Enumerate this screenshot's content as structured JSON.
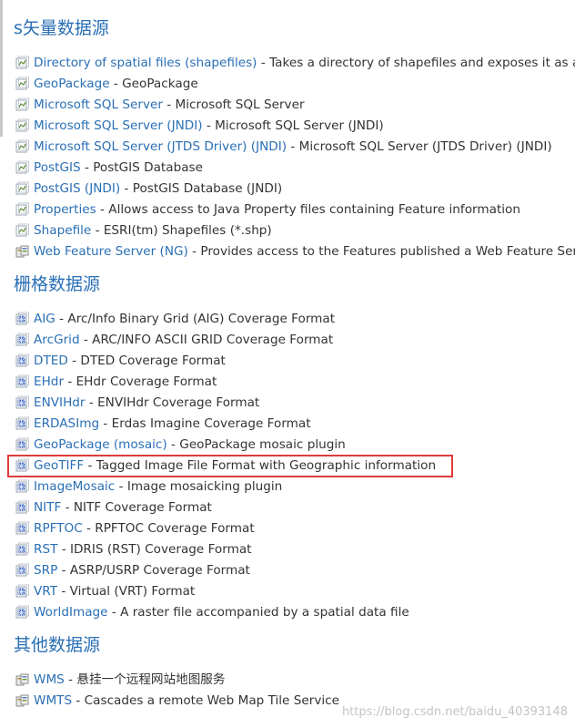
{
  "vector_section": {
    "title": "s矢量数据源",
    "items": [
      {
        "name": "Directory of spatial files (shapefiles)",
        "desc": "Takes a directory of shapefiles and exposes it as a data store",
        "icon": "vector-icon"
      },
      {
        "name": "GeoPackage",
        "desc": "GeoPackage",
        "icon": "vector-icon"
      },
      {
        "name": "Microsoft SQL Server",
        "desc": "Microsoft SQL Server",
        "icon": "vector-icon"
      },
      {
        "name": "Microsoft SQL Server (JNDI)",
        "desc": "Microsoft SQL Server (JNDI)",
        "icon": "vector-icon"
      },
      {
        "name": "Microsoft SQL Server (JTDS Driver) (JNDI)",
        "desc": "Microsoft SQL Server (JTDS Driver) (JNDI)",
        "icon": "vector-icon"
      },
      {
        "name": "PostGIS",
        "desc": "PostGIS Database",
        "icon": "vector-icon"
      },
      {
        "name": "PostGIS (JNDI)",
        "desc": "PostGIS Database (JNDI)",
        "icon": "vector-icon"
      },
      {
        "name": "Properties",
        "desc": "Allows access to Java Property files containing Feature information",
        "icon": "vector-icon"
      },
      {
        "name": "Shapefile",
        "desc": "ESRI(tm) Shapefiles (*.shp)",
        "icon": "vector-icon"
      },
      {
        "name": "Web Feature Server (NG)",
        "desc": "Provides access to the Features published a Web Feature Service, and th",
        "icon": "server-icon"
      }
    ]
  },
  "raster_section": {
    "title": "栅格数据源",
    "items": [
      {
        "name": "AIG",
        "desc": "Arc/Info Binary Grid (AIG) Coverage Format",
        "icon": "raster-icon"
      },
      {
        "name": "ArcGrid",
        "desc": "ARC/INFO ASCII GRID Coverage Format",
        "icon": "raster-icon"
      },
      {
        "name": "DTED",
        "desc": "DTED Coverage Format",
        "icon": "raster-icon"
      },
      {
        "name": "EHdr",
        "desc": "EHdr Coverage Format",
        "icon": "raster-icon"
      },
      {
        "name": "ENVIHdr",
        "desc": "ENVIHdr Coverage Format",
        "icon": "raster-icon"
      },
      {
        "name": "ERDASImg",
        "desc": "Erdas Imagine Coverage Format",
        "icon": "raster-icon"
      },
      {
        "name": "GeoPackage (mosaic)",
        "desc": "GeoPackage mosaic plugin",
        "icon": "raster-icon"
      },
      {
        "name": "GeoTIFF",
        "desc": "Tagged Image File Format with Geographic information",
        "icon": "raster-icon"
      },
      {
        "name": "ImageMosaic",
        "desc": "Image mosaicking plugin",
        "icon": "raster-icon"
      },
      {
        "name": "NITF",
        "desc": "NITF Coverage Format",
        "icon": "raster-icon"
      },
      {
        "name": "RPFTOC",
        "desc": "RPFTOC Coverage Format",
        "icon": "raster-icon"
      },
      {
        "name": "RST",
        "desc": "IDRIS (RST) Coverage Format",
        "icon": "raster-icon"
      },
      {
        "name": "SRP",
        "desc": "ASRP/USRP Coverage Format",
        "icon": "raster-icon"
      },
      {
        "name": "VRT",
        "desc": "Virtual (VRT) Format",
        "icon": "raster-icon"
      },
      {
        "name": "WorldImage",
        "desc": "A raster file accompanied by a spatial data file",
        "icon": "raster-icon"
      }
    ]
  },
  "other_section": {
    "title": "其他数据源",
    "items": [
      {
        "name": "WMS",
        "desc": "悬挂一个远程网站地图服务",
        "icon": "server-icon"
      },
      {
        "name": "WMTS",
        "desc": "Cascades a remote Web Map Tile Service",
        "icon": "server-icon"
      }
    ]
  },
  "separator": " - ",
  "watermark": "https://blog.csdn.net/baidu_40393148",
  "colors": {
    "link": "#2a6fb5",
    "heading": "#2a6fb5",
    "highlight_border": "#e03b3b"
  }
}
